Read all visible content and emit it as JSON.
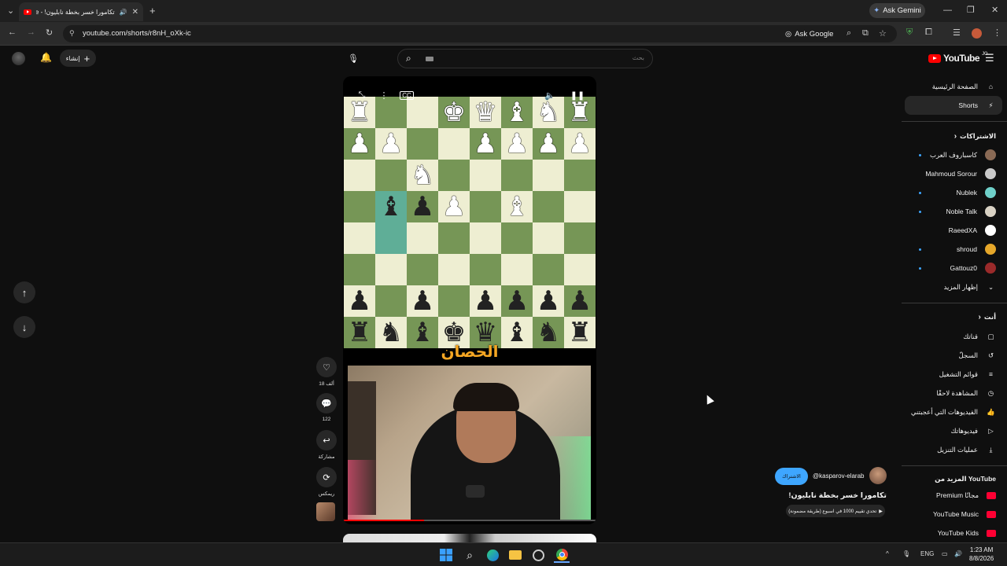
{
  "browser": {
    "tab_title": "تكامورا خسر بخطة نابليون! - e",
    "url": "youtube.com/shorts/r8nH_oXk-ic",
    "ask_google": "Ask Google",
    "ask_gemini": "Ask Gemini"
  },
  "header": {
    "create_label": "إنشاء",
    "search_placeholder": "بحث",
    "logo_text": "YouTube",
    "logo_region": "JO"
  },
  "sidebar": {
    "main": [
      {
        "label": "الصفحة الرئيسية",
        "icon": "home-icon"
      },
      {
        "label": "Shorts",
        "icon": "shorts-icon",
        "active": true
      }
    ],
    "subscriptions_heading": "الاشتراكات",
    "subscriptions": [
      {
        "label": "كاسباروف العرب",
        "color": "#8a6a55",
        "dot": true
      },
      {
        "label": "Mahmoud Sorour",
        "color": "#c9c9c9",
        "dot": false
      },
      {
        "label": "Nublek",
        "color": "#6fd0c9",
        "dot": true
      },
      {
        "label": "Noble Talk",
        "color": "#d9d2c4",
        "dot": true
      },
      {
        "label": "RaeedXA",
        "color": "#ffffff",
        "dot": false
      },
      {
        "label": "shroud",
        "color": "#e6a72a",
        "dot": true
      },
      {
        "label": "Gattouz0",
        "color": "#9a2a2a",
        "dot": true
      }
    ],
    "show_more": "إظهار المزيد",
    "you_heading": "أنت",
    "you_items": [
      {
        "label": "قناتك",
        "icon": "channel-icon"
      },
      {
        "label": "السجلّ",
        "icon": "history-icon"
      },
      {
        "label": "قوائم التشغيل",
        "icon": "playlists-icon"
      },
      {
        "label": "المشاهدة لاحقًا",
        "icon": "watch-later-icon"
      },
      {
        "label": "الفيديوهات التي أعجبتني",
        "icon": "liked-icon"
      },
      {
        "label": "فيديوهاتك",
        "icon": "your-videos-icon"
      },
      {
        "label": "عمليات التنزيل",
        "icon": "downloads-icon"
      }
    ],
    "more_from_heading": "المزيد من YouTube",
    "more_from": [
      {
        "label": "Premium مجانًا",
        "color": "#ff0033"
      },
      {
        "label": "YouTube Music",
        "color": "#ff0033"
      },
      {
        "label": "YouTube Kids",
        "color": "#ff0033"
      }
    ]
  },
  "short": {
    "caption": "الحصان",
    "progress": 0.32,
    "likes": "18 ألف",
    "comments": "122",
    "share_label": "مشاركة",
    "remix_label": "ريمكس",
    "channel_handle": "@kasparov-elarab",
    "subscribe_label": "الاشتراك",
    "title": "تكامورا خسر بخطة نابليون!",
    "playlist_chip": "تحدي تقييم 1000 في اسبوع (طريقة مضمونة)"
  },
  "board": [
    [
      "wR",
      "",
      "",
      "wK",
      "wQ",
      "wB",
      "wN",
      "wR"
    ],
    [
      "wP",
      "wP",
      "",
      "",
      "wP",
      "wP",
      "wP",
      "wP"
    ],
    [
      "",
      "",
      "wN",
      "",
      "",
      "",
      "",
      ""
    ],
    [
      "",
      "bB",
      "bP",
      "wP",
      "",
      "wB",
      "",
      ""
    ],
    [
      "",
      "",
      "",
      "",
      "",
      "",
      "",
      ""
    ],
    [
      "",
      "",
      "",
      "",
      "",
      "",
      "",
      ""
    ],
    [
      "bP",
      "",
      "bP",
      "",
      "bP",
      "bP",
      "bP",
      "bP"
    ],
    [
      "bR",
      "bN",
      "bB",
      "bK",
      "bQ",
      "bB",
      "bN",
      "bR"
    ]
  ],
  "taskbar": {
    "time": "1:23 AM",
    "date": "8/8/2026",
    "lang": "ENG"
  }
}
